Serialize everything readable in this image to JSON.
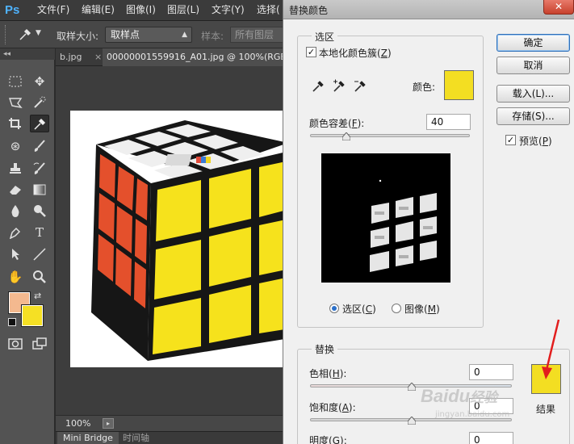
{
  "app": {
    "logo": "Ps"
  },
  "menubar": {
    "items": [
      "文件(F)",
      "编辑(E)",
      "图像(I)",
      "图层(L)",
      "文字(Y)",
      "选择("
    ]
  },
  "options": {
    "sample_size_label": "取样大小:",
    "sample_size_value": "取样点",
    "sample_label": "样本:",
    "sample_value": "所有图层"
  },
  "toolbar": {
    "collapse_glyph": "◂◂",
    "tools": [
      "marquee-icon",
      "move-icon",
      "lasso-icon",
      "quick-select-icon",
      "crop-icon",
      "eyedropper-icon",
      "healing-icon",
      "brush-icon",
      "stamp-icon",
      "history-brush-icon",
      "eraser-icon",
      "gradient-icon",
      "blur-icon",
      "dodge-icon",
      "pen-icon",
      "type-icon",
      "path-select-icon",
      "line-icon",
      "hand-icon",
      "zoom-icon",
      "quick-mask-icon",
      "screen-mode-icon"
    ],
    "foreground_color": "#f4b98f",
    "background_color": "#f5e024"
  },
  "document": {
    "tabs": [
      "b.jpg",
      "00000001559916_A01.jpg @ 100%(RGB"
    ],
    "zoom": "100%",
    "bottom_tabs": [
      "Mini Bridge",
      "时间轴"
    ]
  },
  "dialog": {
    "title": "替换颜色",
    "selection_group": "选区",
    "localized_label": "本地化颜色簇",
    "localized_key": "Z",
    "localized_checked": true,
    "color_label": "颜色:",
    "color_swatch": "#f3de22",
    "fuzziness_label": "颜色容差",
    "fuzziness_key": "F",
    "fuzziness_value": "40",
    "fuzziness_fraction": 0.2,
    "radio_selection": "选区",
    "radio_selection_key": "C",
    "radio_image": "图像",
    "radio_image_key": "M",
    "replacement_group": "替换",
    "hue_label": "色相",
    "hue_key": "H",
    "hue_value": "0",
    "saturation_label": "饱和度",
    "saturation_key": "A",
    "saturation_value": "0",
    "lightness_label": "明度",
    "lightness_key": "G",
    "lightness_value": "0",
    "result_label": "结果",
    "result_swatch": "#f3de22",
    "buttons": {
      "ok": "确定",
      "cancel": "取消",
      "load": "载入(L)...",
      "save": "存储(S)...",
      "preview": "预览",
      "preview_key": "P",
      "preview_checked": true
    }
  },
  "watermark": {
    "brand": "Baidu",
    "brand_suffix": "经验",
    "url": "jingyan.baidu.com"
  }
}
